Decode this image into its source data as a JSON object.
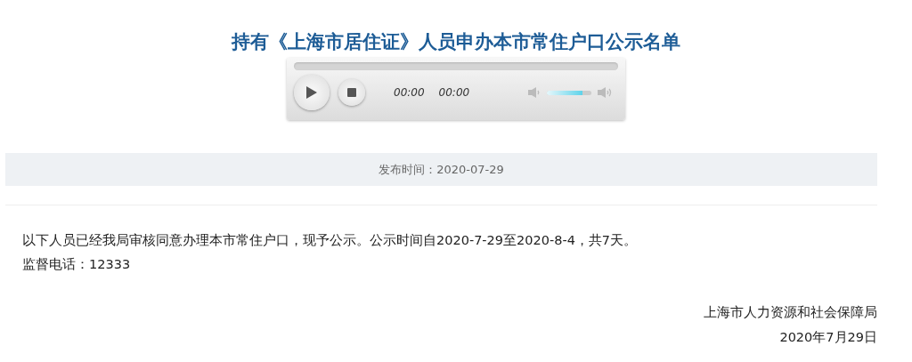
{
  "title": "持有《上海市居住证》人员申办本市常住户口公示名单",
  "player": {
    "current_time": "00:00",
    "duration": "00:00",
    "volume": {
      "level": 0.8
    }
  },
  "publish_info": "发布时间：2020-07-29",
  "body": [
    "以下人员已经我局审核同意办理本市常住户口，现予公示。公示时间自2020-7-29至2020-8-4，共7天。",
    "监督电话：12333"
  ],
  "signature": {
    "organization": "上海市人力资源和社会保障局",
    "date": "2020年7月29日"
  }
}
